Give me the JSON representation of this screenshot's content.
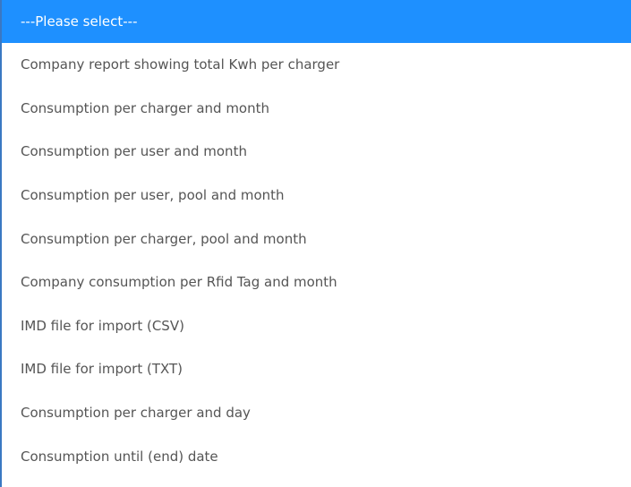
{
  "dropdown": {
    "selected_label": "---Please select---",
    "options": [
      "Company report showing total Kwh per charger",
      "Consumption per charger and month",
      "Consumption per user and month",
      "Consumption per user, pool and month",
      "Consumption per charger, pool and month",
      "Company consumption per Rfid Tag and month",
      "IMD file for import (CSV)",
      "IMD file for import (TXT)",
      "Consumption per charger and day",
      "Consumption until (end) date"
    ],
    "colors": {
      "highlight": "#1e90ff",
      "text": "#555555",
      "border": "#3a78c2"
    }
  }
}
